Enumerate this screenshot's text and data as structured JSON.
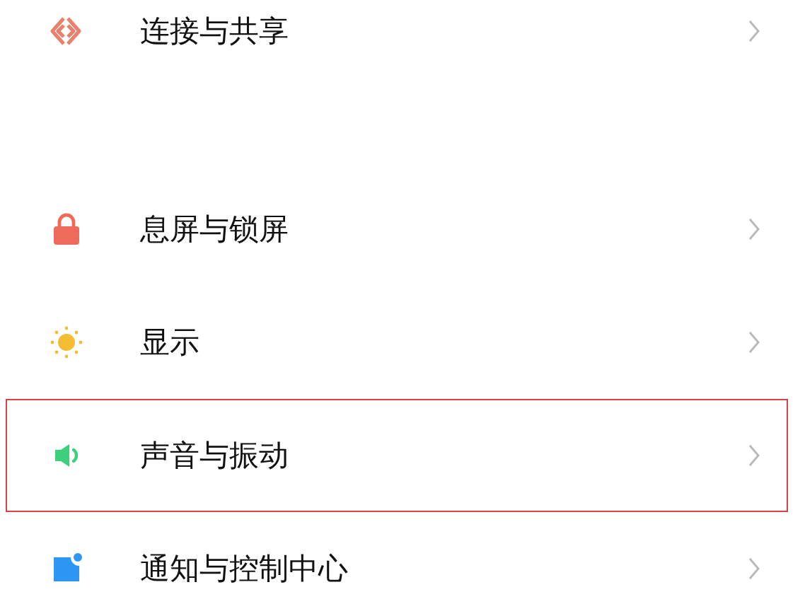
{
  "sections": [
    {
      "items": [
        {
          "kind": "connect",
          "label": "连接与共享",
          "selected": false
        }
      ]
    },
    {
      "items": [
        {
          "kind": "lock",
          "label": "息屏与锁屏",
          "selected": false
        },
        {
          "kind": "sun",
          "label": "显示",
          "selected": false
        },
        {
          "kind": "sound",
          "label": "声音与振动",
          "selected": true
        },
        {
          "kind": "notify",
          "label": "通知与控制中心",
          "selected": false
        }
      ]
    }
  ]
}
